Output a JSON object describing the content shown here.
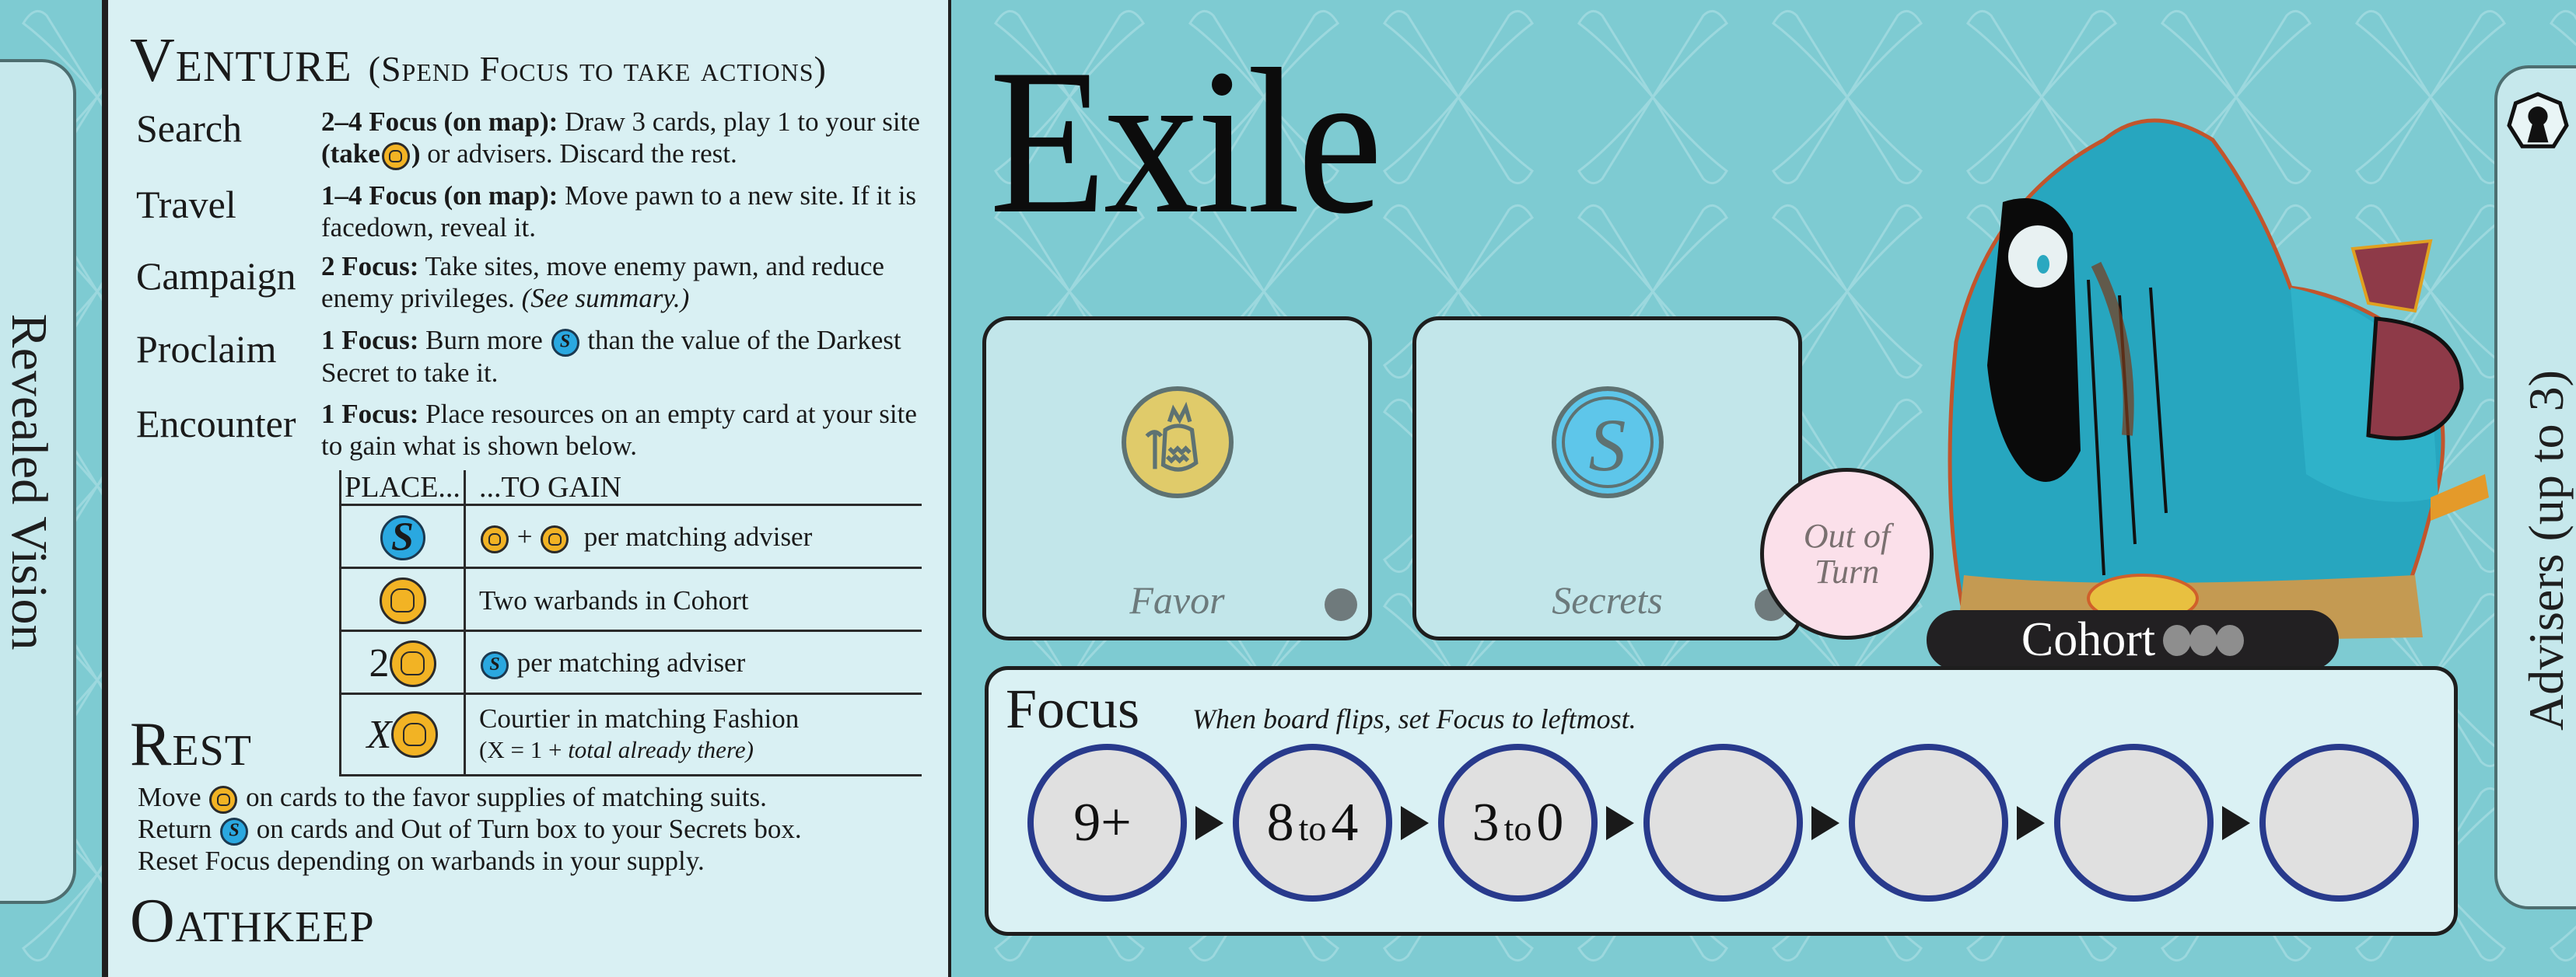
{
  "board": {
    "title": "Exile",
    "colors": {
      "background": "#7ecbd2",
      "panel": "#d9f0f3",
      "favor": "#f2b324",
      "secret": "#2aa8e0",
      "focus_ring": "#283a8c",
      "out_of_turn": "#fbe0ea"
    }
  },
  "left_tab": {
    "label": "Revealed Vision"
  },
  "right_tab": {
    "label": "Advisers (up to 3)",
    "icon": "pawn-icon"
  },
  "rules": {
    "venture": {
      "heading_initial": "V",
      "heading_rest": "ENTURE",
      "subheading": "(Spend Focus to take actions)",
      "actions": [
        {
          "name": "Search",
          "cost": "2–4 Focus (on map):",
          "text1": " Draw 3 cards, play 1 to your site ",
          "bold2": "(take",
          "bold2_close": ")",
          "text2": " or advisers. Discard the rest."
        },
        {
          "name": "Travel",
          "cost": "1–4 Focus (on map):",
          "text": " Move pawn to a new site. If it is facedown, reveal it."
        },
        {
          "name": "Campaign",
          "cost": "2 Focus:",
          "text": " Take sites, move enemy pawn, and reduce enemy privileges. ",
          "italic": "(See summary.)"
        },
        {
          "name": "Proclaim",
          "cost": "1 Focus:",
          "text1": " Burn more ",
          "text2": " than the value of the Darkest Secret to take it."
        },
        {
          "name": "Encounter",
          "cost": "1 Focus:",
          "text": " Place resources on an empty card at your site to gain what is shown below."
        }
      ],
      "table": {
        "headers": [
          "PLACE...",
          "...TO GAIN"
        ],
        "rows": [
          {
            "place_count": "",
            "place_icon": "secret",
            "gain": "per matching adviser",
            "gain_prefix": "favor+favor"
          },
          {
            "place_count": "",
            "place_icon": "favor",
            "gain": "Two warbands in Cohort"
          },
          {
            "place_count": "2",
            "place_icon": "favor",
            "gain": "per matching adviser",
            "gain_prefix": "secret"
          },
          {
            "place_count": "X",
            "place_icon": "favor",
            "gain": "Courtier in matching Fashion",
            "gain_note_a": "(X = 1 + ",
            "gain_note_b": "total already there)"
          }
        ]
      }
    },
    "rest": {
      "heading_initial": "R",
      "heading_rest": "EST",
      "lines": [
        {
          "pre": "Move ",
          "icon": "favor",
          "post": " on cards to the favor supplies of matching suits."
        },
        {
          "pre": "Return ",
          "icon": "secret",
          "post": " on cards and Out of Turn box to your Secrets box."
        },
        {
          "pre": "Reset Focus depending on warbands in your supply.",
          "icon": "",
          "post": ""
        }
      ]
    },
    "oathkeep": {
      "heading_initial": "O",
      "heading_rest": "ATHKEEP"
    }
  },
  "supply": {
    "favor_label": "Favor",
    "secrets_label": "Secrets",
    "out_of_turn_line1": "Out of",
    "out_of_turn_line2": "Turn"
  },
  "cohort": {
    "label": "Cohort",
    "slots": 3
  },
  "focus": {
    "title": "Focus",
    "hint": "When board flips, set Focus to leftmost.",
    "slots": [
      {
        "a": "9+",
        "to": "",
        "b": ""
      },
      {
        "a": "8",
        "to": "to",
        "b": "4"
      },
      {
        "a": "3",
        "to": "to",
        "b": "0"
      },
      {
        "a": "",
        "to": "",
        "b": ""
      },
      {
        "a": "",
        "to": "",
        "b": ""
      },
      {
        "a": "",
        "to": "",
        "b": ""
      },
      {
        "a": "",
        "to": "",
        "b": ""
      }
    ]
  }
}
